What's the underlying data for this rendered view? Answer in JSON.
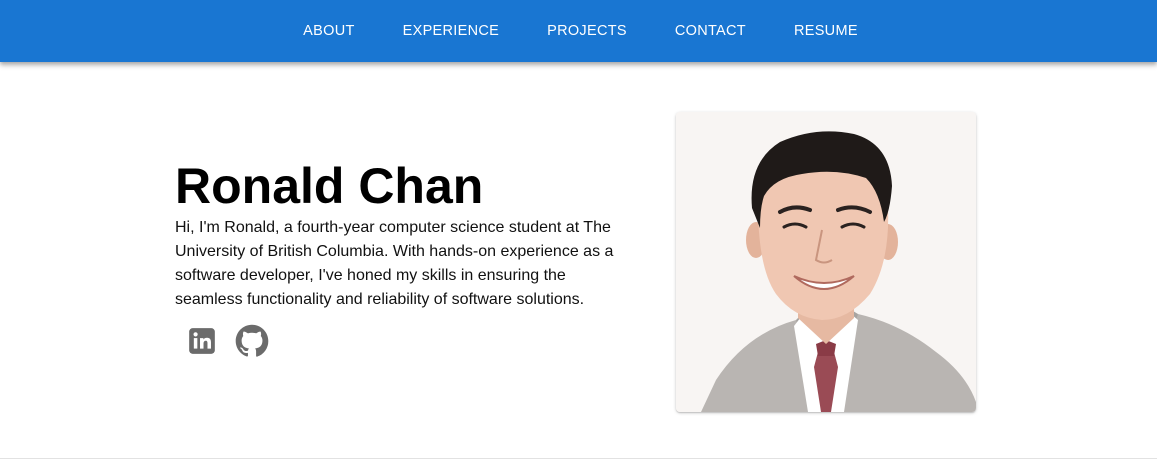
{
  "nav": {
    "items": [
      {
        "label": "ABOUT"
      },
      {
        "label": "EXPERIENCE"
      },
      {
        "label": "PROJECTS"
      },
      {
        "label": "CONTACT"
      },
      {
        "label": "RESUME"
      }
    ]
  },
  "hero": {
    "name": "Ronald Chan",
    "bio": "Hi, I'm Ronald, a fourth-year computer science student at The University of British Columbia. With hands-on experience as a software developer, I've honed my skills in ensuring the seamless functionality and reliability of software solutions.",
    "socials": [
      {
        "icon": "linkedin-icon"
      },
      {
        "icon": "github-icon"
      }
    ]
  },
  "colors": {
    "navbar": "#1976d2",
    "icon": "#6b6b6b"
  }
}
